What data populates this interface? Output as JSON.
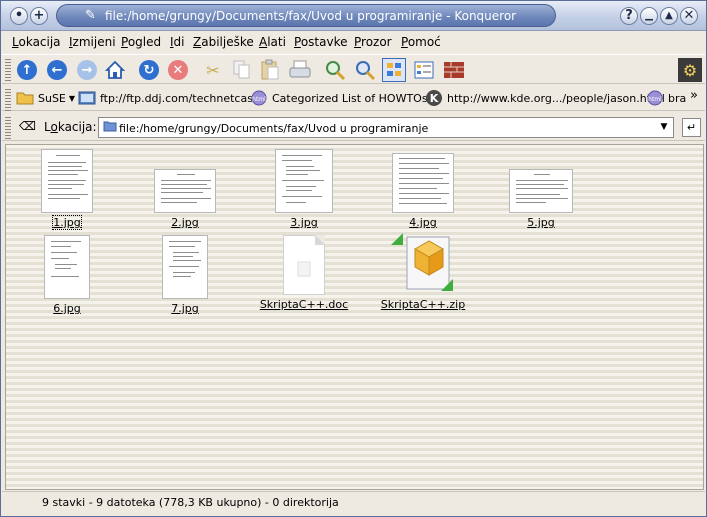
{
  "window": {
    "title": "file:/home/grungy/Documents/fax/Uvod u programiranje - Konqueror"
  },
  "menubar": {
    "items": [
      {
        "label": "Lokacija",
        "key": "L",
        "rest": "okacija"
      },
      {
        "label": "Izmijeni",
        "key": "I",
        "rest": "zmijeni"
      },
      {
        "label": "Pogled",
        "key": "P",
        "rest": "ogled"
      },
      {
        "label": "Idi",
        "key": "I",
        "rest": "di"
      },
      {
        "label": "Zabilješke",
        "key": "Z",
        "rest": "abilješke"
      },
      {
        "label": "Alati",
        "key": "A",
        "rest": "lati"
      },
      {
        "label": "Postavke",
        "key": "P",
        "rest": "ostavke"
      },
      {
        "label": "Prozor",
        "key": "P",
        "rest": "rozor"
      },
      {
        "label": "Pomoć",
        "key": "P",
        "rest": "omoć"
      }
    ]
  },
  "toolbar": {
    "icons": [
      "up-icon",
      "back-icon",
      "forward-icon",
      "home-icon",
      "reload-icon",
      "stop-icon",
      "cut-icon",
      "copy-icon",
      "paste-icon",
      "print-icon",
      "zoom-in-icon",
      "zoom-out-icon",
      "icon-view-icon",
      "detail-view-icon",
      "security-icon",
      "konqueror-throbber-icon"
    ]
  },
  "bookmarks": {
    "items": [
      {
        "label": "SuSE",
        "icon": "folder-icon"
      },
      {
        "label": "ftp://ftp.ddj.com/technetcast/",
        "icon": "ftp-icon"
      },
      {
        "label": "Categorized List of HOWTOs",
        "icon": "html-icon"
      },
      {
        "label": "http://www.kde.org.../people/jason.html",
        "icon": "kde-icon"
      },
      {
        "label": "bra",
        "icon": "html-icon"
      }
    ],
    "overflow": "»"
  },
  "location": {
    "label_key": "o",
    "label_pre": "L",
    "label_post": "kacija:",
    "value": "file:/home/grungy/Documents/fax/Uvod u programiranje"
  },
  "files": [
    {
      "name": "1.jpg",
      "type": "image"
    },
    {
      "name": "2.jpg",
      "type": "image"
    },
    {
      "name": "3.jpg",
      "type": "image"
    },
    {
      "name": "4.jpg",
      "type": "image"
    },
    {
      "name": "5.jpg",
      "type": "image"
    },
    {
      "name": "6.jpg",
      "type": "image"
    },
    {
      "name": "7.jpg",
      "type": "image"
    },
    {
      "name": "SkriptaC++.doc",
      "type": "document"
    },
    {
      "name": "SkriptaC++.zip",
      "type": "archive"
    }
  ],
  "status": {
    "text": "9 stavki - 9 datoteka (778,3 KB ukupno) - 0 direktorija"
  }
}
